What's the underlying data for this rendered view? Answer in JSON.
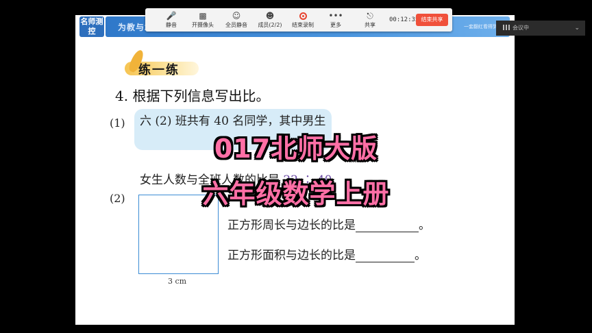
{
  "banner": {
    "brand": "名师测控",
    "text": "为教与增效 为学生赋能",
    "right_text": "一套翻红看得到"
  },
  "toolbar": {
    "items": [
      {
        "label": "静音",
        "icon": "microphone-icon"
      },
      {
        "label": "开摄像头",
        "icon": "camera-icon"
      },
      {
        "label": "全员静音",
        "icon": "mute-all-icon"
      },
      {
        "label": "成员(2/2)",
        "icon": "members-icon"
      },
      {
        "label": "结束录制",
        "icon": "record-icon"
      },
      {
        "label": "更多",
        "icon": "more-icon"
      },
      {
        "label": "共享",
        "icon": "share-icon"
      }
    ],
    "timer": "00:12:35",
    "end_share": "结束共享"
  },
  "meeting": {
    "label": "会议中"
  },
  "lesson": {
    "practice_label": "练一练",
    "question_title": "4. 根据下列信息写出比。",
    "part1_num": "(1)",
    "part1_text": "六 (2) 班共有 40 名同学，其中男生",
    "girls_text": "女生人数与全班人数的比是",
    "girls_answer": "22 ∶ 40",
    "part2_num": "(2)",
    "side_label": "3 cm",
    "line_perimeter": "正方形周长与边长的比是",
    "line_area": "正方形面积与边长的比是",
    "period": "。"
  },
  "overlay": {
    "line1": "017北师大版",
    "line2": "六年级数学上册"
  },
  "colors": {
    "overlay_text": "#ff6fa6",
    "banner": "#2f78c9",
    "end_button": "#f0503a",
    "bubble": "#d7ecf8"
  }
}
